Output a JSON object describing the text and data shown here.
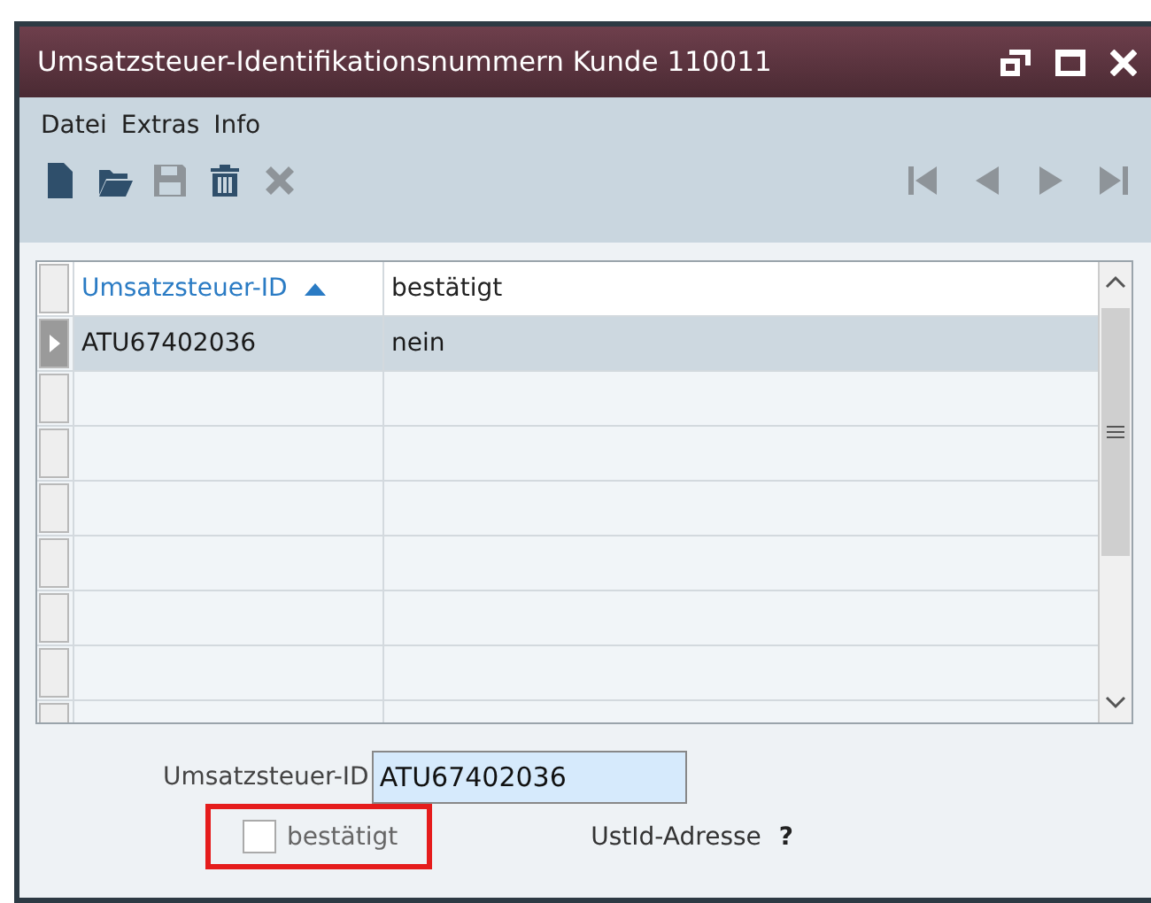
{
  "window": {
    "title": "Umsatzsteuer-Identifikationsnummern Kunde 110011"
  },
  "menu": [
    "Datei",
    "Extras",
    "Info"
  ],
  "toolbar": [
    {
      "kind": "new",
      "disabled": false
    },
    {
      "kind": "open",
      "disabled": false
    },
    {
      "kind": "save",
      "disabled": true
    },
    {
      "kind": "delete",
      "disabled": false
    },
    {
      "kind": "cancel",
      "disabled": true
    }
  ],
  "navigation": [
    {
      "kind": "first",
      "disabled": true
    },
    {
      "kind": "prev",
      "disabled": true
    },
    {
      "kind": "next",
      "disabled": true
    },
    {
      "kind": "last",
      "disabled": true
    }
  ],
  "table": {
    "columns": [
      {
        "label": "Umsatzsteuer-ID",
        "sorted": true
      },
      {
        "label": "bestätigt",
        "sorted": false
      }
    ],
    "rows": [
      {
        "cells": [
          "ATU67402036",
          "nein"
        ],
        "selected": true
      },
      {
        "cells": [],
        "selected": false
      },
      {
        "cells": [],
        "selected": false
      },
      {
        "cells": [],
        "selected": false
      },
      {
        "cells": [],
        "selected": false
      },
      {
        "cells": [],
        "selected": false
      },
      {
        "cells": [],
        "selected": false
      },
      {
        "cells": [],
        "selected": false
      }
    ]
  },
  "form": {
    "id_label": "Umsatzsteuer-ID",
    "id_value": "ATU67402036",
    "confirmed": {
      "label": "bestätigt",
      "checked": false,
      "highlighted": true
    },
    "address_label": "UstId-Adresse",
    "help": "?"
  }
}
